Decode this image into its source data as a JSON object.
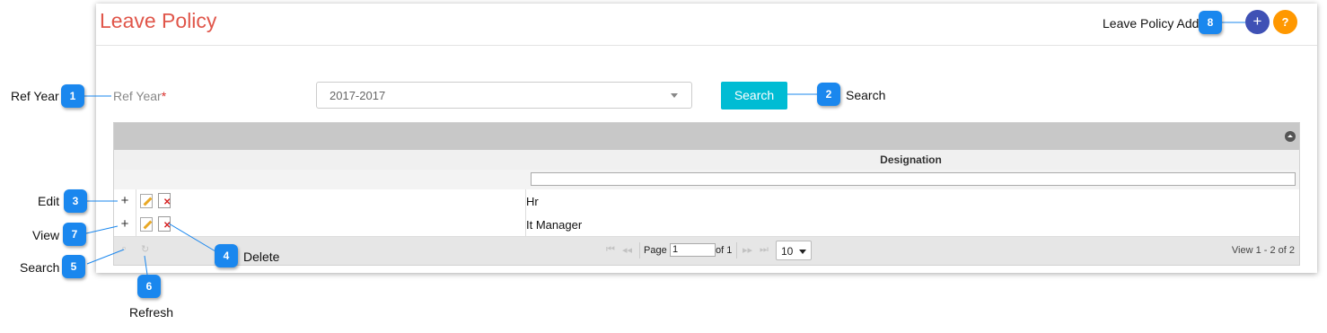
{
  "header": {
    "title": "Leave Policy",
    "add_label": "Leave Policy Add",
    "add_button": "+",
    "help_button": "?"
  },
  "form": {
    "ref_year_label": "Ref Year",
    "required_mark": "*",
    "ref_year_value": "2017-2017",
    "search_button": "Search"
  },
  "grid": {
    "column_header": "Designation",
    "expand_symbol": "+",
    "rows": [
      {
        "designation": "Hr"
      },
      {
        "designation": "It Manager"
      }
    ],
    "pager": {
      "page_label": "Page",
      "page_value": "1",
      "of_label": "of 1",
      "page_size": "10",
      "view_info": "View 1 - 2 of 2"
    }
  },
  "callouts": [
    {
      "number": "1",
      "label": "Ref Year"
    },
    {
      "number": "2",
      "label": "Search"
    },
    {
      "number": "3",
      "label": "Edit"
    },
    {
      "number": "4",
      "label": "Delete"
    },
    {
      "number": "5",
      "label": "Search"
    },
    {
      "number": "6",
      "label": "Refresh"
    },
    {
      "number": "7",
      "label": "View"
    },
    {
      "number": "8",
      "label": ""
    }
  ],
  "colors": {
    "title": "#e0564a",
    "search_button": "#00bcd4",
    "add_button": "#3f51b5",
    "help_button": "#ff9800",
    "callout": "#1a87ee"
  }
}
